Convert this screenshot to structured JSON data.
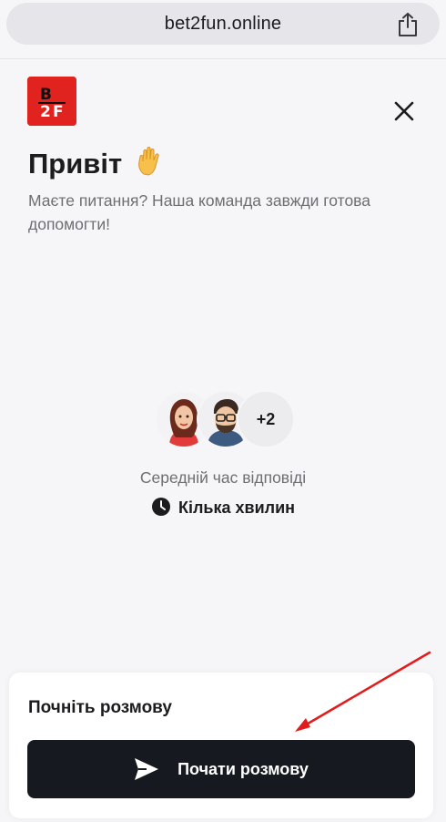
{
  "browser": {
    "url": "bet2fun.online"
  },
  "header": {
    "logo_text": "B2F",
    "greeting": "Привіт",
    "greeting_emoji": "✋",
    "subtitle": "Маєте питання? Наша команда завжди готова допомогти!"
  },
  "team": {
    "extra_count": "+2"
  },
  "response": {
    "label": "Середній час відповіді",
    "value": "Кілька хвилин"
  },
  "conversation": {
    "card_title": "Почніть розмову",
    "button_label": "Почати розмову"
  },
  "colors": {
    "logo_bg": "#e0231f",
    "button_bg": "#16191f",
    "annotation_arrow": "#e21b1b"
  }
}
